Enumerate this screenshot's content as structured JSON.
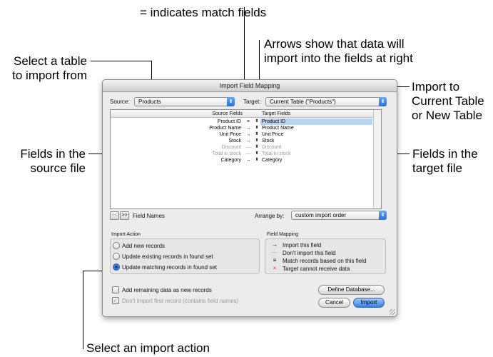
{
  "callouts": {
    "match_fields": "= indicates match fields",
    "arrows_1": "Arrows show that data will",
    "arrows_2": "import into the fields at right",
    "select_table_1": "Select a table",
    "select_table_2": "to import from",
    "import_to_1": "Import to",
    "import_to_2": "Current Table",
    "import_to_3": "or New Table",
    "fields_source_1": "Fields in the",
    "fields_source_2": "source file",
    "fields_target_1": "Fields in the",
    "fields_target_2": "target file",
    "select_action": "Select an import action"
  },
  "dialog": {
    "title": "Import Field Mapping",
    "source_label": "Source:",
    "source_value": "Products",
    "target_label": "Target:",
    "target_value": "Current Table (\"Products\")",
    "col_source": "Source Fields",
    "col_target": "Target Fields",
    "rows": [
      {
        "source": "Product ID",
        "arrow": "=",
        "target": "Product ID",
        "selected": true,
        "dim": false
      },
      {
        "source": "Product Name",
        "arrow": "→",
        "target": "Product Name",
        "selected": false,
        "dim": false
      },
      {
        "source": "Unit Price",
        "arrow": "→",
        "target": "Unit Price",
        "selected": false,
        "dim": false
      },
      {
        "source": "Stock",
        "arrow": "→",
        "target": "Stock",
        "selected": false,
        "dim": false
      },
      {
        "source": "Discount",
        "arrow": "—",
        "target": "Discount",
        "selected": false,
        "dim": true
      },
      {
        "source": "Total in stock",
        "arrow": "—",
        "target": "Total in stock",
        "selected": false,
        "dim": true
      },
      {
        "source": "Category",
        "arrow": "→",
        "target": "Category",
        "selected": false,
        "dim": false
      }
    ],
    "nav_prev": "<<",
    "nav_next": ">>",
    "field_names": "Field Names",
    "arrange_label": "Arrange by:",
    "arrange_value": "custom import order",
    "import_action_title": "Import Action",
    "actions": [
      {
        "label": "Add new records",
        "selected": false
      },
      {
        "label": "Update existing records in found set",
        "selected": false
      },
      {
        "label": "Update matching records in found set",
        "selected": true
      }
    ],
    "field_mapping_title": "Field Mapping",
    "legend": [
      {
        "symbol": "→",
        "label": "Import this field",
        "color": "#000000"
      },
      {
        "symbol": "—",
        "label": "Don't import this field",
        "color": "#9a9a9a"
      },
      {
        "symbol": "≡",
        "label": "Match records based on this field",
        "color": "#000000"
      },
      {
        "symbol": "×",
        "label": "Target cannot receive data",
        "color": "#d62020"
      }
    ],
    "add_remaining": "Add remaining data as new records",
    "dont_import_first": "Don't import first record (contains field names)",
    "define_db": "Define Database...",
    "cancel": "Cancel",
    "import": "Import"
  }
}
